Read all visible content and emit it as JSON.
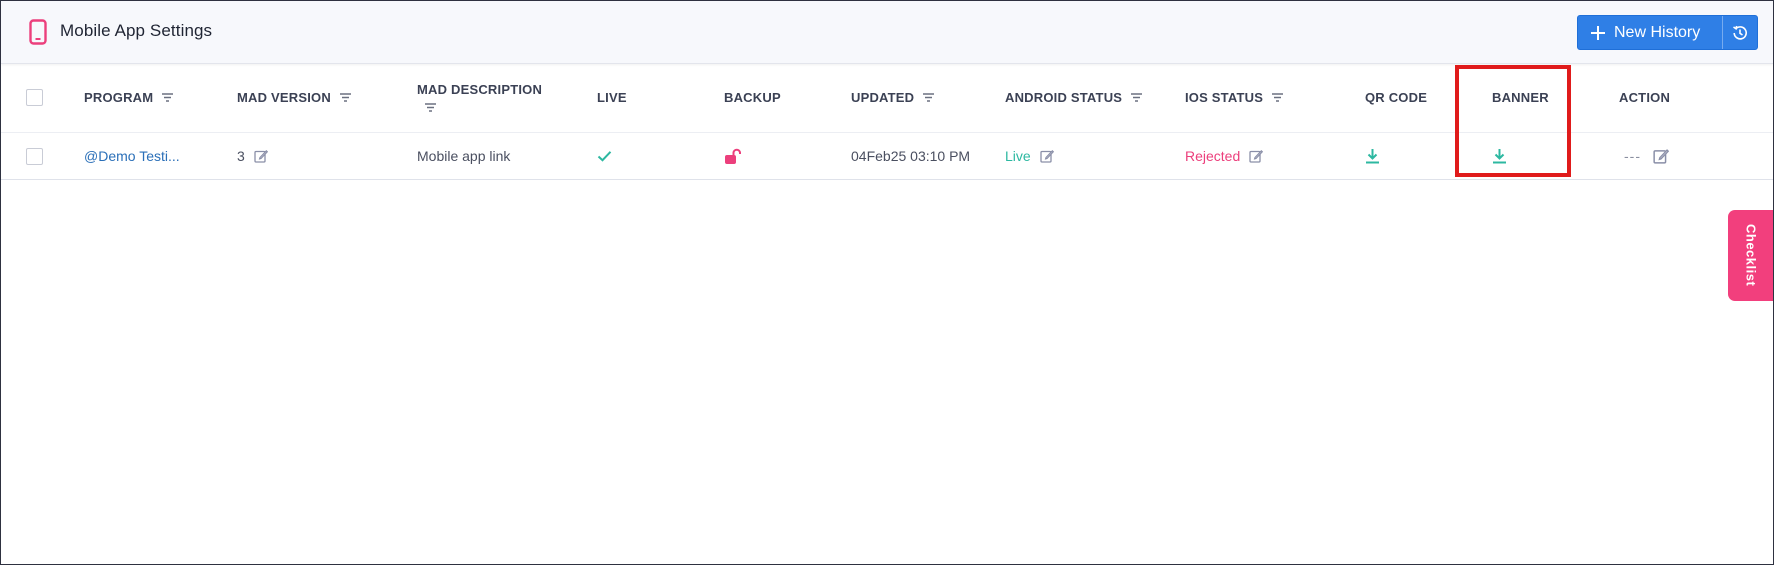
{
  "header": {
    "title": "Mobile App Settings",
    "new_history_label": "New History"
  },
  "table": {
    "columns": {
      "program": "PROGRAM",
      "mad_version": "MAD VERSION",
      "mad_description": "MAD DESCRIPTION",
      "live": "LIVE",
      "backup": "BACKUP",
      "updated": "UPDATED",
      "android_status": "ANDROID STATUS",
      "ios_status": "IOS STATUS",
      "qr_code": "QR CODE",
      "banner": "BANNER",
      "action": "ACTION"
    },
    "rows": [
      {
        "program": "@Demo Testi...",
        "mad_version": "3",
        "mad_description": "Mobile app link",
        "live": true,
        "backup_locked": false,
        "updated": "04Feb25 03:10 PM",
        "android_status": "Live",
        "ios_status": "Rejected",
        "action_menu": "---"
      }
    ]
  },
  "checklist": {
    "label": "Checklist"
  },
  "colors": {
    "primary": "#2f7fe6",
    "accent_pink": "#f23f7d",
    "success_teal": "#2db8a1",
    "rejected_pink": "#ec3f7c",
    "link_blue": "#2a6fb8",
    "highlight_red": "#e01b1b"
  },
  "icons": {
    "page": "mobile-phone-icon",
    "new": "plus-icon",
    "history": "history-icon",
    "filter": "filter-icon",
    "edit": "edit-icon",
    "live": "checkmark-icon",
    "backup": "unlocked-icon",
    "download": "download-icon"
  }
}
